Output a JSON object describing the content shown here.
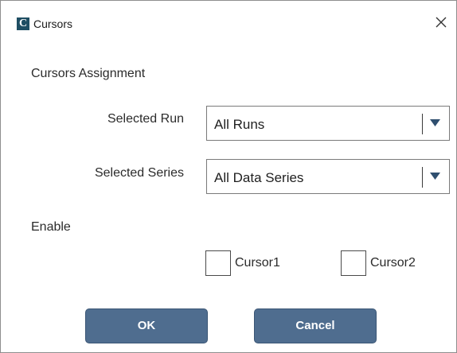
{
  "window": {
    "title": "Cursors",
    "app_icon_letter": "C",
    "icon": "app-logo-icon",
    "close_icon": "close-icon"
  },
  "assignment": {
    "section_label": "Cursors Assignment",
    "selected_run": {
      "label": "Selected Run",
      "value": "All Runs"
    },
    "selected_series": {
      "label": "Selected Series",
      "value": "All Data Series"
    }
  },
  "enable": {
    "section_label": "Enable",
    "cursor1": {
      "label": "Cursor1",
      "checked": false
    },
    "cursor2": {
      "label": "Cursor2",
      "checked": false
    }
  },
  "actions": {
    "ok_label": "OK",
    "cancel_label": "Cancel"
  },
  "colors": {
    "button_bg": "#4f6d8f",
    "app_icon_bg": "#1f4e63"
  }
}
